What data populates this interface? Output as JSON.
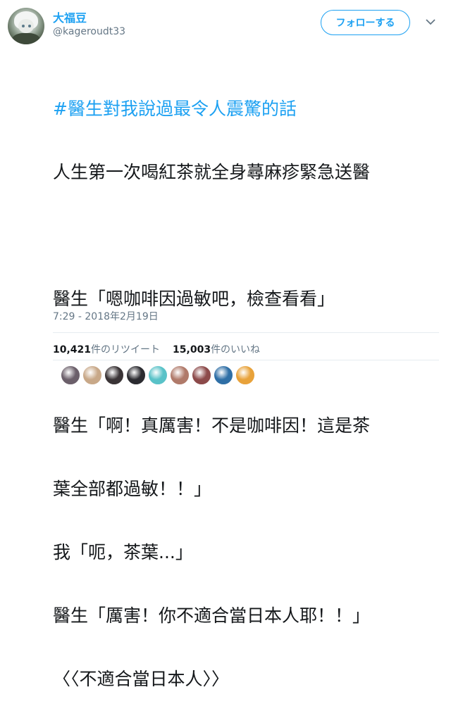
{
  "user": {
    "display_name": "大福豆",
    "handle": "@kageroudt33",
    "follow_label": "フォローする"
  },
  "tweet": {
    "hashtag": "#醫生對我說過最令人震驚的話",
    "lines": [
      "人生第一次喝紅茶就全身蕁麻疹緊急送醫",
      "",
      "醫生「嗯咖啡因過敏吧，檢查看看」",
      "",
      "醫生「啊！真厲害！不是咖啡因！這是茶",
      "葉全部都過敏！！」",
      "我「呃，茶葉...」",
      "醫生「厲害！你不適合當日本人耶！！」",
      "〈〈不適合當日本人〉〉"
    ],
    "timestamp": "7:29 - 2018年2月19日"
  },
  "stats": {
    "retweet_count": "10,421",
    "retweet_label": "件のリツイート",
    "like_count": "15,003",
    "like_label": "件のいいね"
  },
  "likers": [
    {
      "icon": "liker-avatar-1",
      "color": "#6b5f6a"
    },
    {
      "icon": "liker-avatar-2",
      "color": "#c8a888"
    },
    {
      "icon": "liker-avatar-3",
      "color": "#3a3436"
    },
    {
      "icon": "liker-avatar-4",
      "color": "#2b2b30"
    },
    {
      "icon": "liker-avatar-5",
      "color": "#59c2c8"
    },
    {
      "icon": "liker-avatar-6",
      "color": "#b07a6a"
    },
    {
      "icon": "liker-avatar-7",
      "color": "#8c4a4a"
    },
    {
      "icon": "liker-avatar-8",
      "color": "#2f6fa6"
    },
    {
      "icon": "liker-avatar-9",
      "color": "#e8a23a"
    }
  ]
}
